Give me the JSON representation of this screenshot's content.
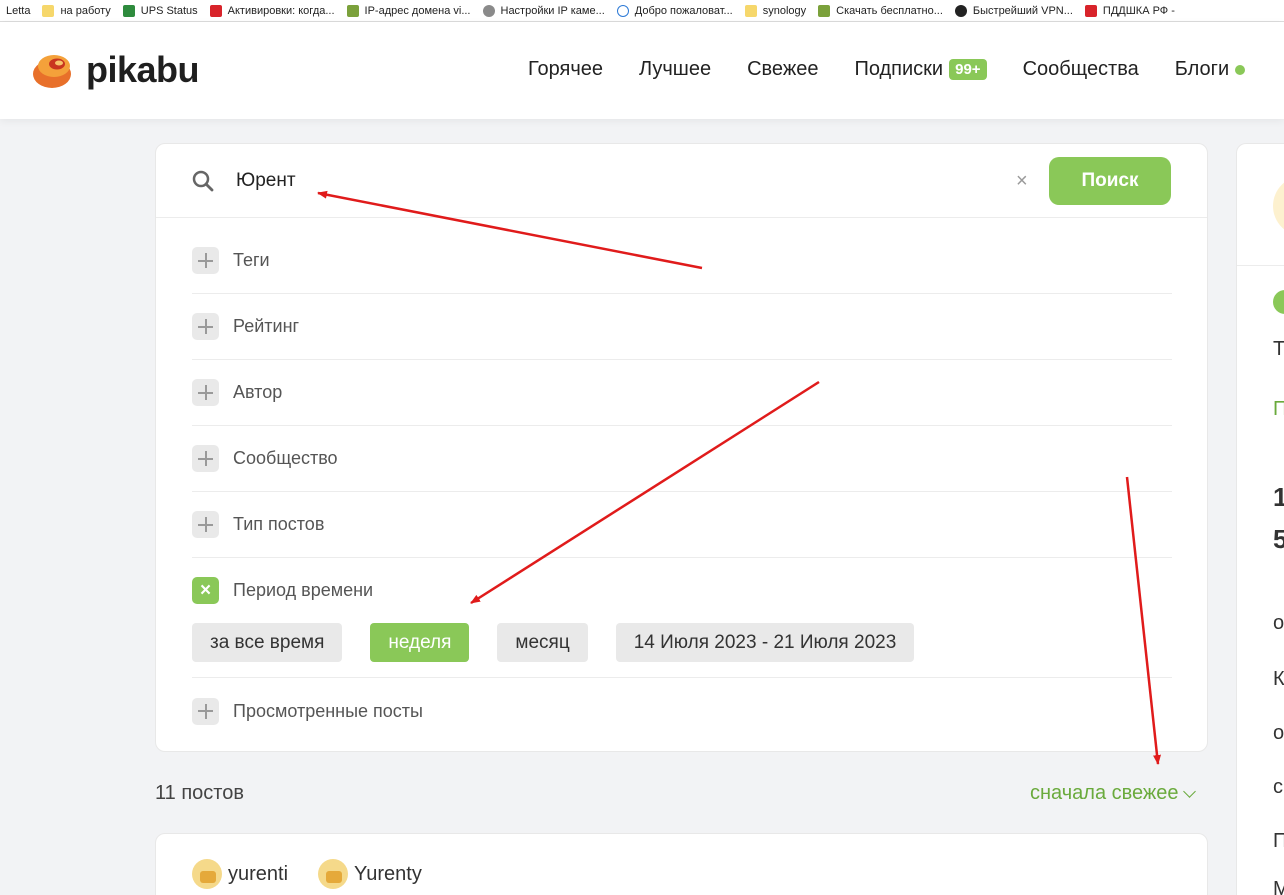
{
  "bookmarks": [
    {
      "label": "Letta",
      "icon": "bookmark-icon",
      "kind": "none"
    },
    {
      "label": "на работу",
      "icon": "folder-icon",
      "kind": "folder"
    },
    {
      "label": "UPS Status",
      "icon": "ups-icon",
      "kind": "green"
    },
    {
      "label": "Активировки: когда...",
      "icon": "red-favicon-icon",
      "kind": "red"
    },
    {
      "label": "IP-адрес домена vi...",
      "icon": "tools-icon",
      "kind": "tool"
    },
    {
      "label": "Настройки IP каме...",
      "icon": "camera-icon",
      "kind": "grey"
    },
    {
      "label": "Добро пожаловат...",
      "icon": "cloud-icon",
      "kind": "cloud"
    },
    {
      "label": "synology",
      "icon": "folder-icon",
      "kind": "folder"
    },
    {
      "label": "Скачать бесплатно...",
      "icon": "download-icon",
      "kind": "tool"
    },
    {
      "label": "Быстрейший VPN...",
      "icon": "vpn-icon",
      "kind": "dark"
    },
    {
      "label": "ПДДШКА РФ -",
      "icon": "pdd-icon",
      "kind": "red"
    }
  ],
  "header": {
    "logo_text": "pikabu",
    "nav": {
      "hot": "Горячее",
      "best": "Лучшее",
      "fresh": "Свежее",
      "subs": "Подписки",
      "subs_badge": "99+",
      "communities": "Сообщества",
      "blogs": "Блоги"
    }
  },
  "search": {
    "query": "Юрент",
    "clear": "×",
    "button": "Поиск"
  },
  "filters": {
    "tags": "Теги",
    "rating": "Рейтинг",
    "author": "Автор",
    "community": "Сообщество",
    "post_type": "Тип постов",
    "period": "Период времени",
    "viewed": "Просмотренные посты"
  },
  "period_options": {
    "all_time": "за все время",
    "week": "неделя",
    "month": "месяц",
    "range": "14 Июля 2023 - 21 Июля 2023",
    "selected": "week"
  },
  "results": {
    "count": "11 постов",
    "sort": "сначала свежее"
  },
  "post": {
    "authors": [
      "yurenti",
      "Yurenty"
    ]
  },
  "sidebar": {
    "t1": "Т",
    "t2": "П",
    "t3": "1",
    "t4": "5",
    "t5": "о",
    "t6": "К",
    "t7": "о",
    "t8": "с",
    "t9": "П",
    "t10": "М"
  },
  "colors": {
    "accent": "#8ac858",
    "accent_text": "#6aaa3c",
    "annotation": "#e01b1b"
  }
}
